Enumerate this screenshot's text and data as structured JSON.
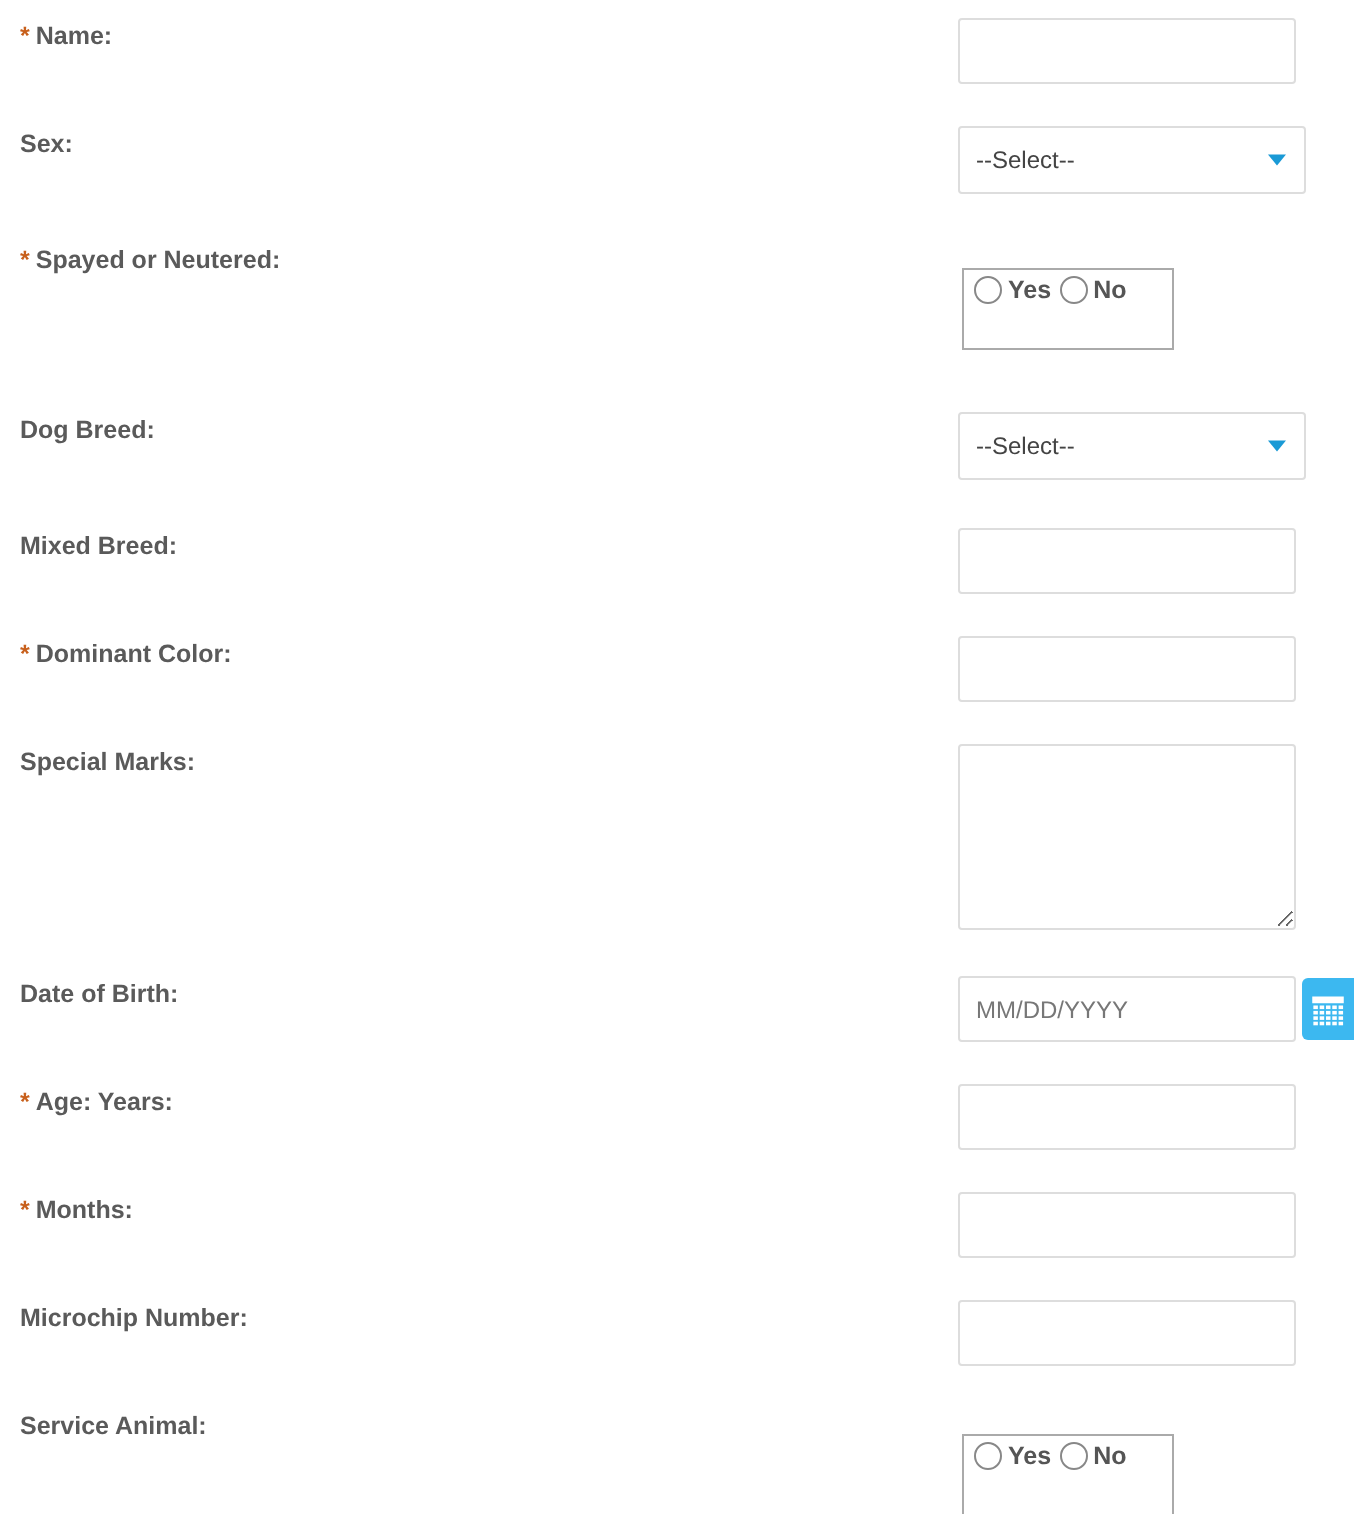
{
  "fields": [
    {
      "kind": "text",
      "label": "Name:",
      "mark": "*"
    },
    {
      "kind": "select",
      "label": "Sex:",
      "value": "--Select--"
    },
    {
      "kind": "radio",
      "label": "Spayed or Neutered:",
      "mark": "*",
      "options": [
        {
          "label": "Yes",
          "selected": false
        },
        {
          "label": "No",
          "selected": false
        }
      ]
    },
    {
      "kind": "select",
      "label": "Dog Breed:",
      "value": "--Select--"
    },
    {
      "kind": "text",
      "label": "Mixed Breed:"
    },
    {
      "kind": "text",
      "label": "Dominant Color:",
      "mark": "*"
    },
    {
      "kind": "textarea",
      "label": "Special Marks:"
    },
    {
      "kind": "date",
      "label": "Date of Birth:",
      "placeholder": "MM/DD/YYYY"
    },
    {
      "kind": "text",
      "label": "Age: Years:",
      "mark": "*"
    },
    {
      "kind": "text",
      "label": "Months:",
      "mark": "*"
    },
    {
      "kind": "text",
      "label": "Microchip Number:"
    },
    {
      "kind": "radio",
      "label": "Service Animal:",
      "options": [
        {
          "label": "Yes",
          "selected": false
        },
        {
          "label": "No",
          "selected": false
        }
      ]
    }
  ]
}
